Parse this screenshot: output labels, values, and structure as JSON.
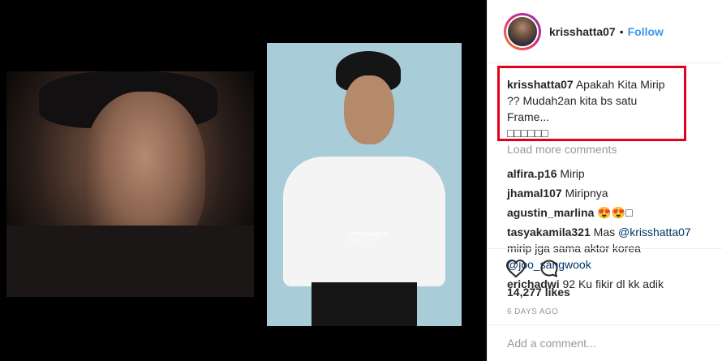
{
  "post": {
    "watermark": "gettyimages",
    "watermark_sub": "Gregg DeGuire"
  },
  "header": {
    "username": "krisshatta07",
    "separator": "•",
    "follow_label": "Follow"
  },
  "caption": {
    "username": "krisshatta07",
    "text": "Apakah Kita Mirip ?? Mudah2an kita bs satu Frame...",
    "emoji_line": "□□□□□□"
  },
  "load_more": "Load more comments",
  "comments": [
    {
      "username": "alfira.p16",
      "text": "Mirip"
    },
    {
      "username": "jhamal107",
      "text": "Miripnya"
    },
    {
      "username": "agustin_marlina",
      "text": "😍😍□"
    },
    {
      "username": "tasyakamila321",
      "text_before": "Mas ",
      "mention1": "@krisshatta07",
      "text_middle": " mirip jga sama aktor korea ",
      "mention2": "@joo_sangwook"
    },
    {
      "username": "erichadwi",
      "text": "92 Ku fikir dl kk adik"
    }
  ],
  "actions": {
    "like_icon": "heart-icon",
    "comment_icon": "comment-bubble-icon"
  },
  "likes": "14,277 likes",
  "date": "6 DAYS AGO",
  "add_comment_placeholder": "Add a comment...",
  "colors": {
    "link": "#3897f0",
    "highlight_box": "#e3001b",
    "muted": "#999999"
  }
}
